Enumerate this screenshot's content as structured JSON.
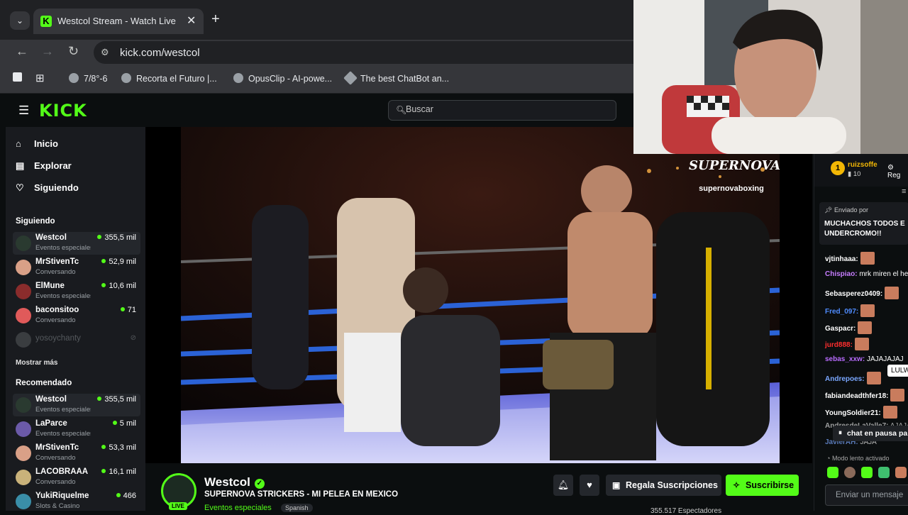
{
  "browser": {
    "tab_title": "Westcol Stream - Watch Live on Kick",
    "tab_list_icon": "chevron-down-icon",
    "url": "kick.com/westcol",
    "bookmarks": [
      {
        "label": "7/8°-6"
      },
      {
        "label": "Recorta el Futuro |..."
      },
      {
        "label": "OpusClip - AI-powe..."
      },
      {
        "label": "The best ChatBot an..."
      }
    ]
  },
  "header": {
    "logo": "KICK",
    "search_placeholder": "Buscar"
  },
  "sidebar": {
    "nav": [
      {
        "label": "Inicio",
        "icon": "home-icon"
      },
      {
        "label": "Explorar",
        "icon": "compass-icon"
      },
      {
        "label": "Siguiendo",
        "icon": "heart-icon"
      }
    ],
    "following_title": "Siguiendo",
    "following": [
      {
        "name": "Westcol",
        "category": "Eventos especiales",
        "viewers": "355,5 mil"
      },
      {
        "name": "MrStivenTc",
        "category": "Conversando",
        "viewers": "52,9 mil"
      },
      {
        "name": "ElMune",
        "category": "Eventos especiales",
        "viewers": "10,6 mil"
      },
      {
        "name": "baconsitoo",
        "category": "Conversando",
        "viewers": "71"
      },
      {
        "name": "yosoychanty",
        "category": "",
        "viewers": ""
      }
    ],
    "show_more": "Mostrar más",
    "recommended_title": "Recomendado",
    "recommended": [
      {
        "name": "Westcol",
        "category": "Eventos especiales",
        "viewers": "355,5 mil"
      },
      {
        "name": "LaParce",
        "category": "Eventos especiales",
        "viewers": "5 mil"
      },
      {
        "name": "MrStivenTc",
        "category": "Conversando",
        "viewers": "53,3 mil"
      },
      {
        "name": "LACOBRAAA",
        "category": "Conversando",
        "viewers": "16,1 mil"
      },
      {
        "name": "YukiRiquelme",
        "category": "Slots & Casino",
        "viewers": "466"
      }
    ]
  },
  "player": {
    "overlay_title": "SUPERNOVA",
    "overlay_handle": "supernovaboxing"
  },
  "channel": {
    "name": "Westcol",
    "live_label": "LIVE",
    "title": "SUPERNOVA STRICKERS - MI PELEA EN MEXICO",
    "category": "Eventos especiales",
    "language": "Spanish",
    "gift_label": "Regala Suscripciones",
    "subscribe_label": "Suscribirse",
    "viewers": "355.517 Espectadores"
  },
  "chat": {
    "leader_rank": "1",
    "leader_name": "ruizsoffe",
    "leader_points": "10",
    "leader_next": "Reg",
    "pinned_by": "Enviado por",
    "pinned_text": "MUCHACHOS TODOS E UNDERCROMO!!",
    "messages": [
      {
        "user": "vjtinhaaa:",
        "text": "",
        "color": "#ffffff"
      },
      {
        "user": "Chispiao:",
        "text": "mrk miren el he",
        "color": "#c77dff"
      },
      {
        "user": "Sebasperez0409:",
        "text": "",
        "color": "#ffffff"
      },
      {
        "user": "Fred_097:",
        "text": "",
        "color": "#4f8cff"
      },
      {
        "user": "Gaspacr:",
        "text": "",
        "color": "#ffffff"
      },
      {
        "user": "jurd888:",
        "text": "",
        "color": "#ff2e2e"
      },
      {
        "user": "sebas_xxw:",
        "text": "JAJAJAJAJ",
        "color": "#b96cff"
      },
      {
        "user": "Andrepoes:",
        "text": "",
        "color": "#7aa7ff"
      },
      {
        "user": "fabiandeadthfer18:",
        "text": "",
        "color": "#ffffff"
      },
      {
        "user": "YoungSoldier21:",
        "text": "",
        "color": "#ffffff"
      },
      {
        "user": "AndresdeLaValle7:",
        "text": "AJAJA",
        "color": "#ffffff"
      },
      {
        "user": "JavierAH:",
        "text": "JAJA",
        "color": "#7aa7ff"
      }
    ],
    "tooltip": "LULW",
    "paused": "chat en pausa pa",
    "slow_mode": "Modo lento activado",
    "input_placeholder": "Enviar un mensaje"
  },
  "colors": {
    "accent": "#53fc18",
    "background": "#0b0e0f",
    "panel": "#191b1f"
  }
}
